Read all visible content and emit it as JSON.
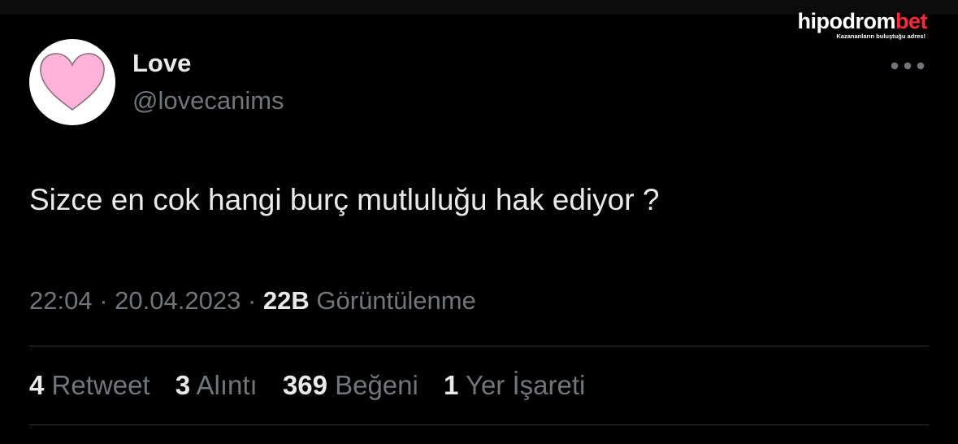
{
  "watermark": {
    "brand_main": "hipodrom",
    "brand_accent": "bet",
    "tagline": "Kazananların buluştuğu adres!",
    "accent_color": "#ff2a3d"
  },
  "tweet": {
    "author": {
      "display_name": "Love",
      "handle": "@lovecanims",
      "avatar_icon": "pink-heart-icon"
    },
    "more_icon": "more-options-icon",
    "text": "Sizce en cok hangi burç mutluluğu hak ediyor ?",
    "time": "22:04",
    "date": "20.04.2023",
    "separator": "·",
    "views_count": "22B",
    "views_label": "Görüntülenme",
    "stats": [
      {
        "count": "4",
        "label": "Retweet"
      },
      {
        "count": "3",
        "label": "Alıntı"
      },
      {
        "count": "369",
        "label": "Beğeni"
      },
      {
        "count": "1",
        "label": "Yer İşareti"
      }
    ]
  },
  "colors": {
    "background": "#000000",
    "primary_text": "#e7e9ea",
    "secondary_text": "#71767b",
    "divider": "#2f3336",
    "heart_fill": "#ffb3d9"
  }
}
